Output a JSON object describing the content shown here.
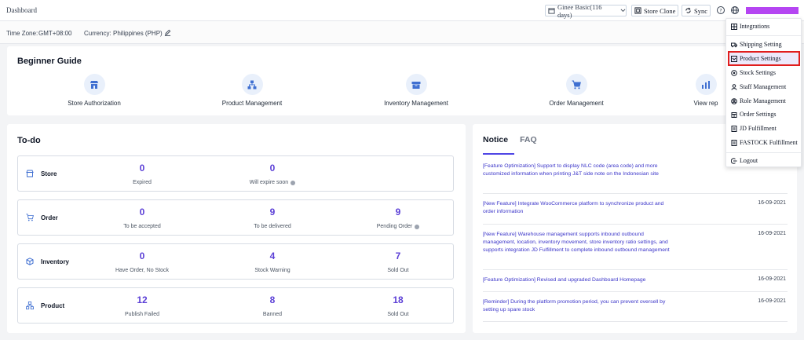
{
  "header": {
    "title": "Dashboard",
    "package_select": "Ginee Basic(116 days)",
    "store_clone": "Store Clone",
    "sync": "Sync"
  },
  "info": {
    "timezone_label": "Time Zone:",
    "timezone_value": "GMT+08:00",
    "currency_label": "Currency:",
    "currency_value": "Philippines (PHP)"
  },
  "guide": {
    "title": "Beginner Guide",
    "items": [
      {
        "label": "Store Authorization",
        "icon": "store-icon"
      },
      {
        "label": "Product Management",
        "icon": "hierarchy-icon"
      },
      {
        "label": "Inventory Management",
        "icon": "box-icon"
      },
      {
        "label": "Order Management",
        "icon": "cart-icon"
      },
      {
        "label": "View rep",
        "icon": "bar-chart-icon"
      }
    ]
  },
  "todo": {
    "title": "To-do",
    "rows": [
      {
        "label": "Store",
        "icon": "shop-icon",
        "stats": [
          {
            "value": "0",
            "label": "Expired"
          },
          {
            "value": "0",
            "label": "Will expire soon"
          }
        ]
      },
      {
        "label": "Order",
        "icon": "cart-icon",
        "stats": [
          {
            "value": "0",
            "label": "To be accepted"
          },
          {
            "value": "9",
            "label": "To be delivered"
          },
          {
            "value": "9",
            "label": "Pending Order"
          }
        ]
      },
      {
        "label": "Inventory",
        "icon": "box-icon",
        "stats": [
          {
            "value": "0",
            "label": "Have Order, No Stock"
          },
          {
            "value": "4",
            "label": "Stock Warning"
          },
          {
            "value": "7",
            "label": "Sold Out"
          }
        ]
      },
      {
        "label": "Product",
        "icon": "hierarchy-icon",
        "stats": [
          {
            "value": "12",
            "label": "Publish Failed"
          },
          {
            "value": "8",
            "label": "Banned"
          },
          {
            "value": "18",
            "label": "Sold Out"
          }
        ]
      }
    ]
  },
  "notice": {
    "tabs": [
      "Notice",
      "FAQ"
    ],
    "items": [
      {
        "text": "[Feature Optimization] Support to display NLC code (area code) and more customized information when printing J&T side note on the Indonesian site",
        "date": ""
      },
      {
        "text": "[New Feature] Integrate WooCommerce platform to synchronize product and order information",
        "date": "16-09-2021"
      },
      {
        "text": "[New Feature] Warehouse management supports inbound outbound management, location, inventory movement, store inventory ratio settings, and supports integration JD Fulfillment to complete inbound outbound management",
        "date": "16-09-2021"
      },
      {
        "text": "[Feature Optimization] Revised and upgraded Dashboard Homepage",
        "date": "16-09-2021"
      },
      {
        "text": "[Reminder] During the platform promotion period, you can prevent oversell by setting up spare stock",
        "date": "16-09-2021"
      }
    ]
  },
  "menu": {
    "items": [
      {
        "label": "Integrations",
        "icon": "grid-icon"
      },
      {
        "label": "Shipping Setting",
        "icon": "truck-icon"
      },
      {
        "label": "Product Settings",
        "icon": "product-icon"
      },
      {
        "label": "Stock Settings",
        "icon": "stock-icon"
      },
      {
        "label": "Staff Management",
        "icon": "person-icon"
      },
      {
        "label": "Role Management",
        "icon": "role-icon"
      },
      {
        "label": "Order Settings",
        "icon": "order-icon"
      },
      {
        "label": "JD Fulfillment",
        "icon": "doc-icon"
      },
      {
        "label": "FASTOCK Fulfillment",
        "icon": "doc-icon"
      },
      {
        "label": "Logout",
        "icon": "logout-icon"
      }
    ]
  },
  "colors": {
    "accent": "#5b3fd6",
    "link": "#3b35c9",
    "user_bar": "#b545f2",
    "highlight_border": "#e11d1d"
  }
}
